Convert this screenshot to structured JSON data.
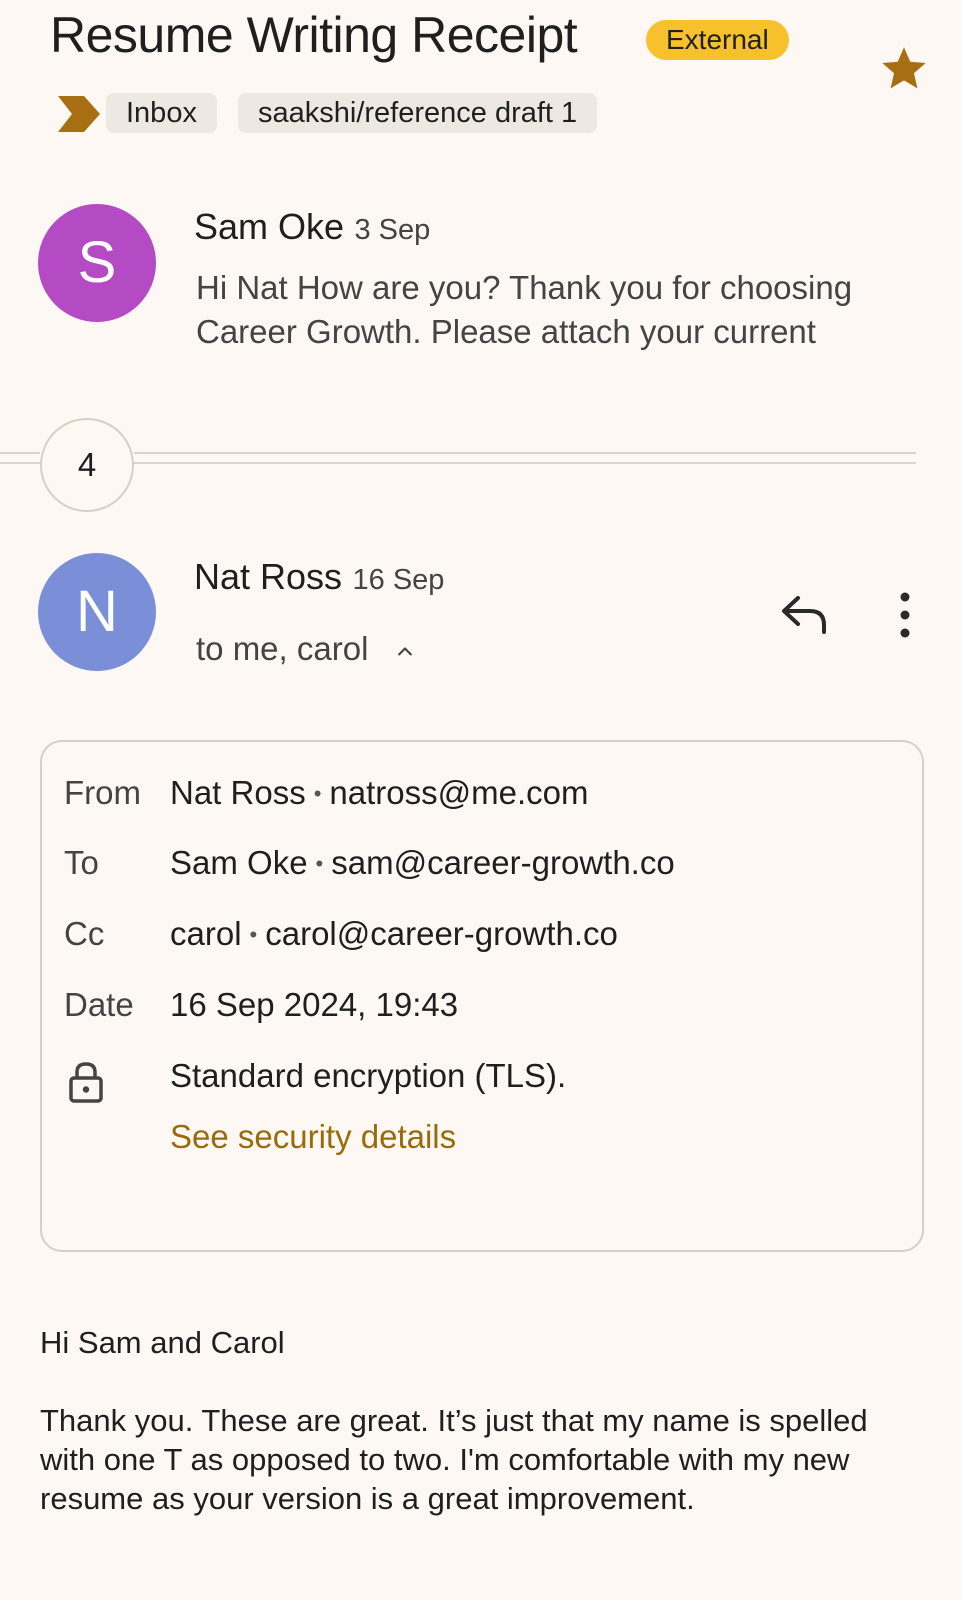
{
  "thread": {
    "subject": "Resume Writing Receipt",
    "external_badge": "External",
    "labels": [
      "Inbox",
      "saakshi/reference draft 1"
    ],
    "colors": {
      "accent": "#a86e12",
      "badge": "#f6c12a",
      "background": "#fdf8f3"
    }
  },
  "messages": [
    {
      "avatar_letter": "S",
      "avatar_color": "#b44bc4",
      "sender": "Sam Oke",
      "date": "3 Sep",
      "snippet": "Hi Nat How are you? Thank you for choosing Career Growth. Please attach your current"
    },
    {
      "avatar_letter": "N",
      "avatar_color": "#7a8fd8",
      "sender": "Nat Ross",
      "date": "16 Sep",
      "recipients": "to me, carol"
    }
  ],
  "collapsed": {
    "count": "4"
  },
  "details": {
    "from_label": "From",
    "from_name": "Nat Ross",
    "from_email": "natross@me.com",
    "to_label": "To",
    "to_name": "Sam Oke",
    "to_email": "sam@career-growth.co",
    "cc_label": "Cc",
    "cc_name": "carol",
    "cc_email": "carol@career-growth.co",
    "date_label": "Date",
    "date_value": "16 Sep 2024, 19:43",
    "security_text": "Standard encryption (TLS).",
    "security_link": "See security details",
    "separator": "•"
  },
  "body": {
    "greeting": "Hi Sam and Carol",
    "paragraph": "Thank you.  These are great.  It’s just that my name is spelled with one T as opposed to two.  I'm comfortable with my new resume as your version is a great improvement."
  },
  "icons": {
    "star": "star-icon",
    "label": "label-arrow-icon",
    "reply": "reply-icon",
    "more": "more-vert-icon",
    "collapse": "chevron-up-icon",
    "lock": "lock-icon"
  }
}
